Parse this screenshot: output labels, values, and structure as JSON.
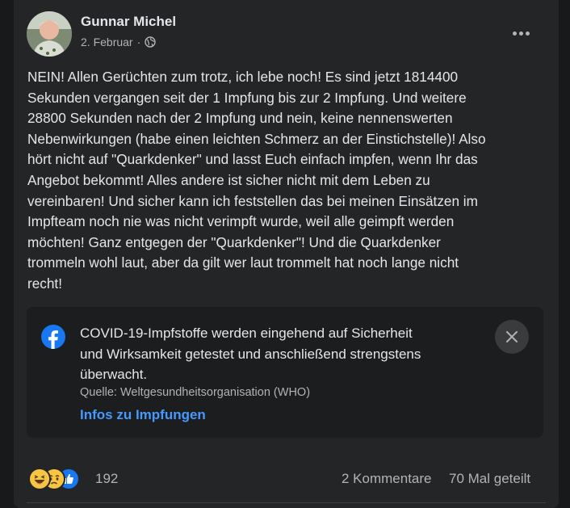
{
  "post": {
    "author": "Gunnar Michel",
    "date": "2. Februar",
    "separator": "·",
    "privacy_icon": "globe-icon",
    "text": "NEIN! Allen Gerüchten zum trotz, ich lebe noch! Es sind jetzt 1814400\nSekunden vergangen seit der 1 Impfung bis zur 2 Impfung. Und weitere\n28800 Sekunden nach der 2 Impfung und nein, keine nennenswerten\nNebenwirkungen (habe einen leichten Schmerz an der Einstichstelle)! Also\nhört nicht auf \"Quarkdenker\" und lasst Euch einfach impfen, wenn Ihr das\nAngebot bekommt! Alles andere ist sicher nicht mit dem Leben zu\nvereinbaren! Und sicher kann ich feststellen das bei meinen Einsätzen im\nImpfteam noch nie was nicht verimpft wurde, weil alle geimpft werden\nmöchten! Ganz entgegen der \"Quarkdenker\"! Und die Quarkdenker\ntrommeln wohl laut, aber da gilt wer laut trommelt hat noch lange nicht\nrecht!"
  },
  "info_box": {
    "icon": "facebook-icon",
    "text": "COVID-19-Impfstoffe werden eingehend auf Sicherheit\nund Wirksamkeit getestet und anschließend strengstens\nüberwacht.",
    "source": "Quelle: Weltgesundheitsorganisation (WHO)",
    "link_label": "Infos zu Impfungen",
    "close_icon": "close-icon"
  },
  "footer": {
    "reactions": [
      "haha-icon",
      "sad-icon",
      "like-icon"
    ],
    "reaction_count": "192",
    "comments": "2 Kommentare",
    "shares": "70 Mal geteilt"
  },
  "colors": {
    "background": "#18191a",
    "card": "#242526",
    "text_primary": "#e4e6eb",
    "text_secondary": "#b0b3b8",
    "link": "#4599ff",
    "facebook_blue": "#1877f2"
  }
}
